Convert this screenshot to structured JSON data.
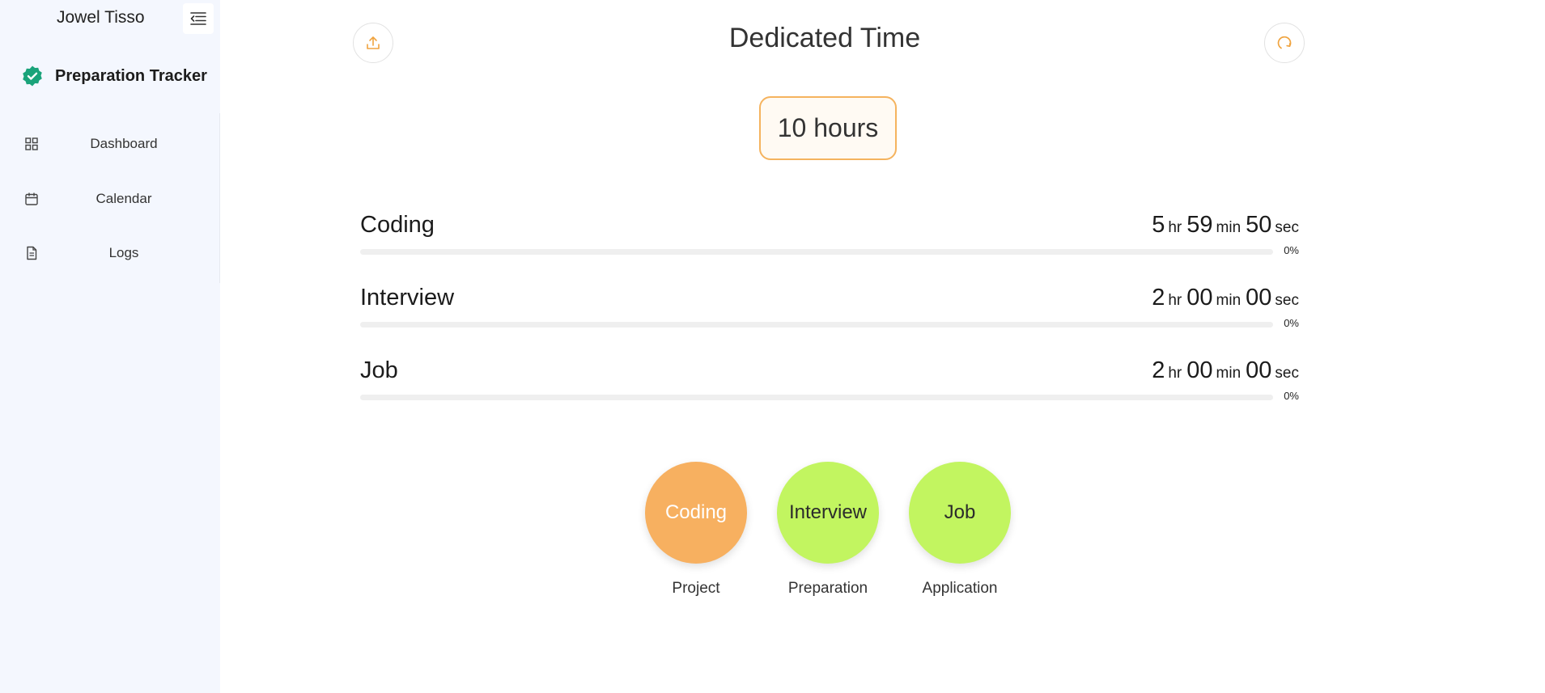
{
  "sidebar": {
    "user_name": "Jowel Tisso",
    "brand": "Preparation Tracker",
    "items": [
      {
        "label": "Dashboard",
        "icon": "dashboard-icon"
      },
      {
        "label": "Calendar",
        "icon": "calendar-icon"
      },
      {
        "label": "Logs",
        "icon": "logs-icon"
      }
    ]
  },
  "main": {
    "title": "Dedicated Time",
    "dedicated_hours": "10 hours",
    "tracks": [
      {
        "name": "Coding",
        "hr": "5",
        "min": "59",
        "sec": "50",
        "percent": "0%",
        "progress": 0
      },
      {
        "name": "Interview",
        "hr": "2",
        "min": "00",
        "sec": "00",
        "percent": "0%",
        "progress": 0
      },
      {
        "name": "Job",
        "hr": "2",
        "min": "00",
        "sec": "00",
        "percent": "0%",
        "progress": 0
      }
    ],
    "units": {
      "hr": "hr",
      "min": "min",
      "sec": "sec"
    },
    "activities": [
      {
        "label": "Coding",
        "sub": "Project",
        "color": "#f7b060",
        "text_color": "#ffffff",
        "active": true
      },
      {
        "label": "Interview",
        "sub": "Preparation",
        "color": "#c2f560",
        "text_color": "#2b2b2b",
        "active": false
      },
      {
        "label": "Job",
        "sub": "Application",
        "color": "#c2f560",
        "text_color": "#2b2b2b",
        "active": false
      }
    ]
  },
  "colors": {
    "accent": "#f5b35e",
    "brand_green": "#1aa37a",
    "sidebar_bg": "#f4f7fe"
  },
  "icons": {
    "menu": "menu-collapse-icon",
    "brand": "verified-badge-icon",
    "export": "upload-icon",
    "reset": "refresh-icon"
  }
}
